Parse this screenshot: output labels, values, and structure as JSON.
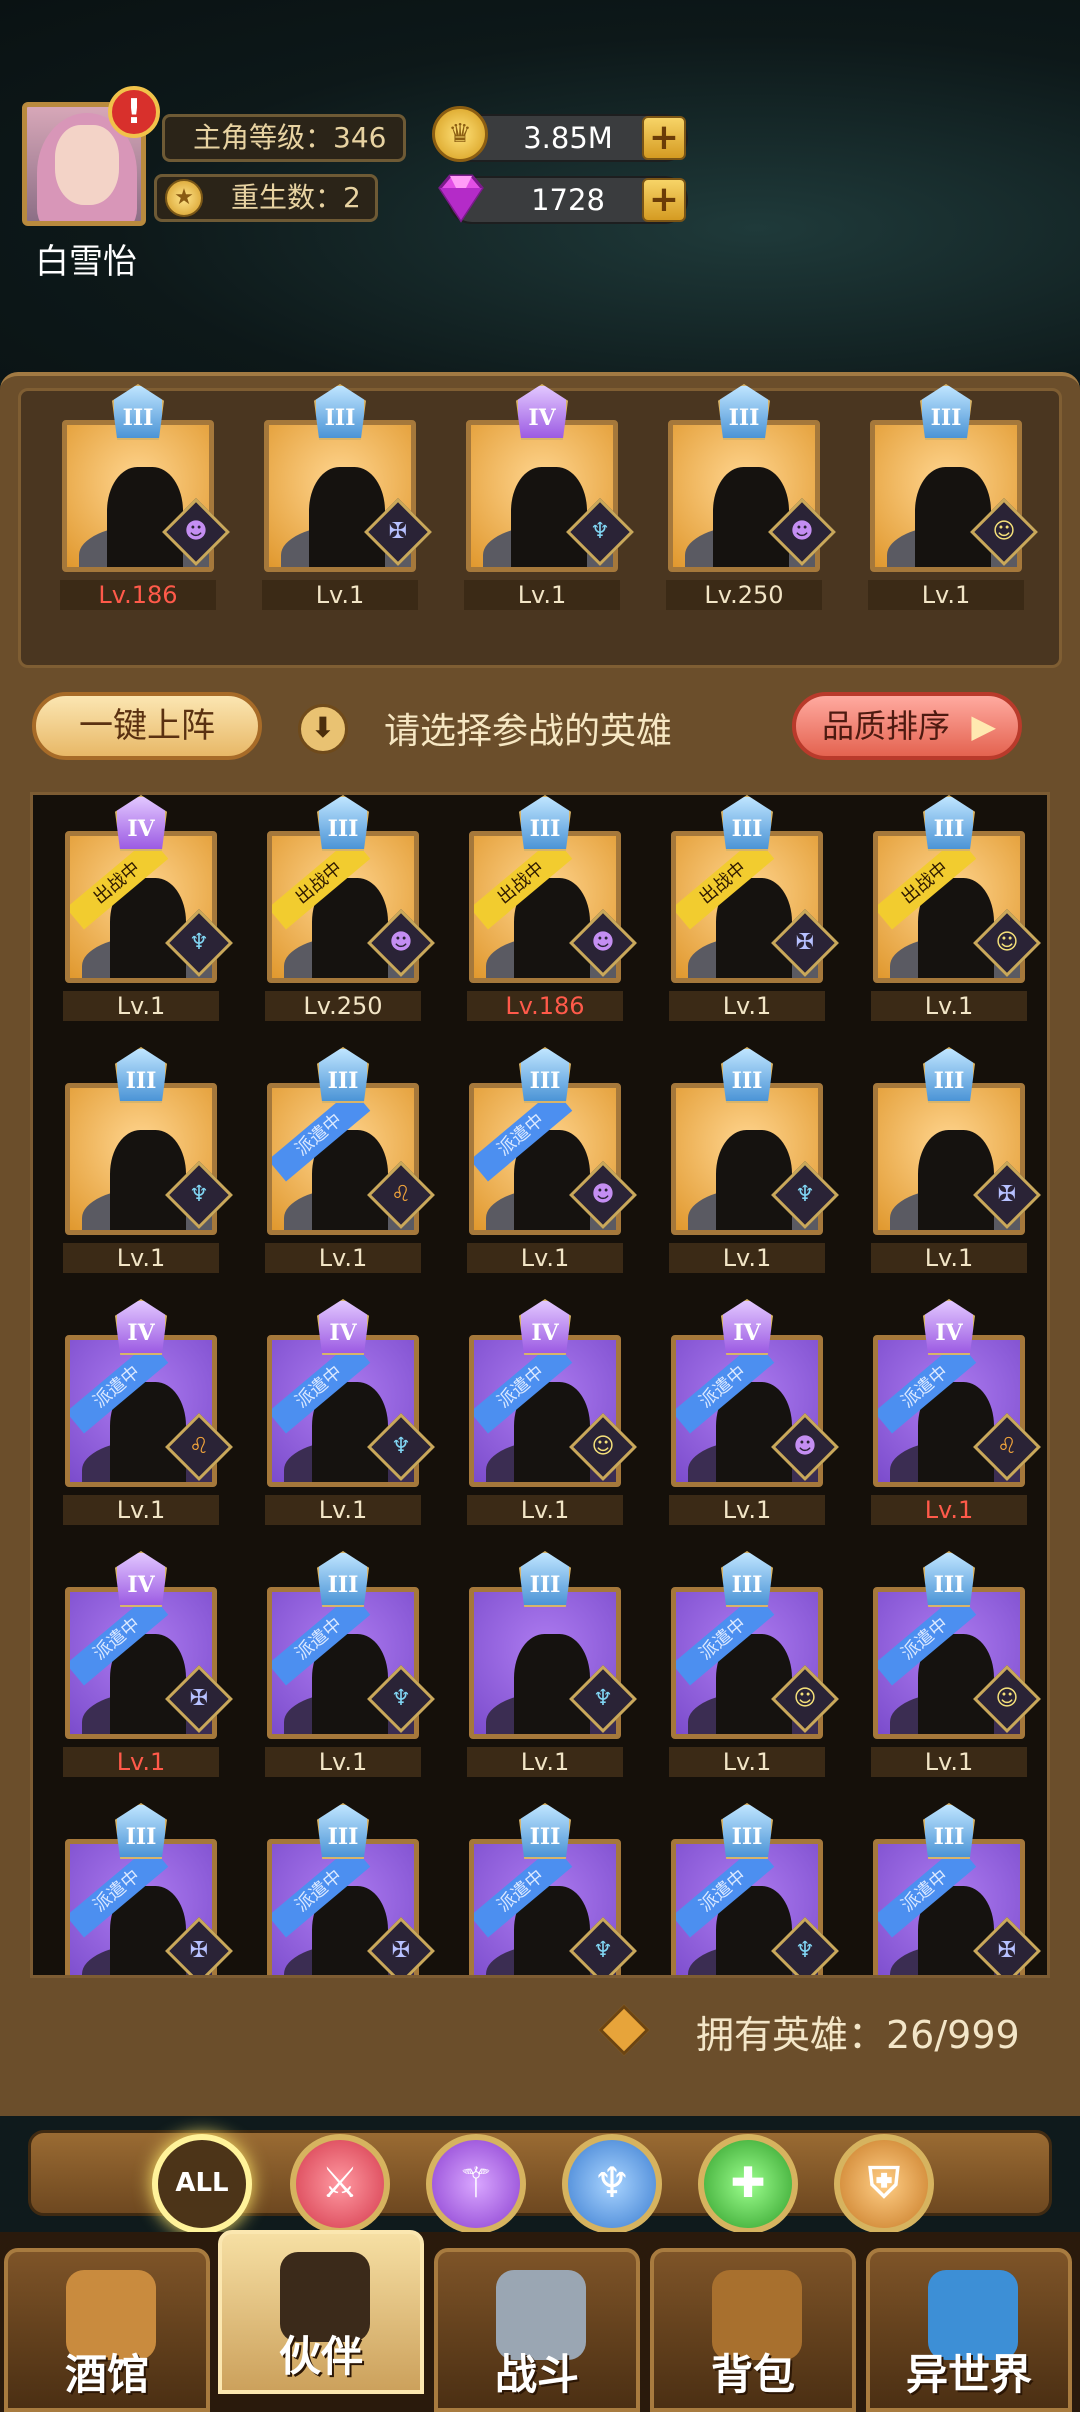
{
  "player": {
    "name": "白雪怡",
    "alert": "!",
    "level_text": "主角等级：346",
    "rebirth_text": "重生数：2",
    "gold": "3.85M",
    "gems": "1728"
  },
  "actions": {
    "deploy_label": "一键上阵",
    "prompt": "请选择参战的英雄",
    "sort_label": "品质排序"
  },
  "team": [
    {
      "tier": "III",
      "level": "Lv.186",
      "red": true,
      "color": "gold",
      "cls": "demon",
      "icon": "demon-icon"
    },
    {
      "tier": "III",
      "level": "Lv.1",
      "red": false,
      "color": "gold",
      "cls": "undead",
      "icon": "knight-icon"
    },
    {
      "tier": "IV",
      "level": "Lv.1",
      "red": false,
      "color": "gold",
      "cls": "elf",
      "icon": "elf-icon"
    },
    {
      "tier": "III",
      "level": "Lv.250",
      "red": false,
      "color": "gold",
      "cls": "demon",
      "icon": "demon-icon"
    },
    {
      "tier": "III",
      "level": "Lv.1",
      "red": false,
      "color": "gold",
      "cls": "human",
      "icon": "human-icon"
    }
  ],
  "roster": [
    {
      "tier": "IV",
      "level": "Lv.1",
      "red": false,
      "color": "gold",
      "status": "出战中",
      "st": "fight",
      "cls": "elf"
    },
    {
      "tier": "III",
      "level": "Lv.250",
      "red": false,
      "color": "gold",
      "status": "出战中",
      "st": "fight",
      "cls": "demon"
    },
    {
      "tier": "III",
      "level": "Lv.186",
      "red": true,
      "color": "gold",
      "status": "出战中",
      "st": "fight",
      "cls": "demon"
    },
    {
      "tier": "III",
      "level": "Lv.1",
      "red": false,
      "color": "gold",
      "status": "出战中",
      "st": "fight",
      "cls": "undead"
    },
    {
      "tier": "III",
      "level": "Lv.1",
      "red": false,
      "color": "gold",
      "status": "出战中",
      "st": "fight",
      "cls": "human"
    },
    {
      "tier": "III",
      "level": "Lv.1",
      "red": false,
      "color": "gold",
      "status": "",
      "st": "",
      "cls": "elf"
    },
    {
      "tier": "III",
      "level": "Lv.1",
      "red": false,
      "color": "gold",
      "status": "派遣中",
      "st": "dispatch",
      "cls": "beast"
    },
    {
      "tier": "III",
      "level": "Lv.1",
      "red": false,
      "color": "gold",
      "status": "派遣中",
      "st": "dispatch",
      "cls": "demon"
    },
    {
      "tier": "III",
      "level": "Lv.1",
      "red": false,
      "color": "gold",
      "status": "",
      "st": "",
      "cls": "elf"
    },
    {
      "tier": "III",
      "level": "Lv.1",
      "red": false,
      "color": "gold",
      "status": "",
      "st": "",
      "cls": "undead"
    },
    {
      "tier": "IV",
      "level": "Lv.1",
      "red": false,
      "color": "purple",
      "status": "派遣中",
      "st": "dispatch",
      "cls": "beast"
    },
    {
      "tier": "IV",
      "level": "Lv.1",
      "red": false,
      "color": "purple",
      "status": "派遣中",
      "st": "dispatch",
      "cls": "elf"
    },
    {
      "tier": "IV",
      "level": "Lv.1",
      "red": false,
      "color": "purple",
      "status": "派遣中",
      "st": "dispatch",
      "cls": "human"
    },
    {
      "tier": "IV",
      "level": "Lv.1",
      "red": false,
      "color": "purple",
      "status": "派遣中",
      "st": "dispatch",
      "cls": "demon"
    },
    {
      "tier": "IV",
      "level": "Lv.1",
      "red": true,
      "color": "purple",
      "status": "派遣中",
      "st": "dispatch",
      "cls": "beast"
    },
    {
      "tier": "IV",
      "level": "Lv.1",
      "red": true,
      "color": "purple",
      "status": "派遣中",
      "st": "dispatch",
      "cls": "undead"
    },
    {
      "tier": "III",
      "level": "Lv.1",
      "red": false,
      "color": "purple",
      "status": "派遣中",
      "st": "dispatch",
      "cls": "elf"
    },
    {
      "tier": "III",
      "level": "Lv.1",
      "red": false,
      "color": "purple",
      "status": "",
      "st": "",
      "cls": "elf"
    },
    {
      "tier": "III",
      "level": "Lv.1",
      "red": false,
      "color": "purple",
      "status": "派遣中",
      "st": "dispatch",
      "cls": "human"
    },
    {
      "tier": "III",
      "level": "Lv.1",
      "red": false,
      "color": "purple",
      "status": "派遣中",
      "st": "dispatch",
      "cls": "human"
    },
    {
      "tier": "III",
      "level": "",
      "red": false,
      "color": "purple",
      "status": "派遣中",
      "st": "dispatch",
      "cls": "undead"
    },
    {
      "tier": "III",
      "level": "",
      "red": false,
      "color": "purple",
      "status": "派遣中",
      "st": "dispatch",
      "cls": "undead"
    },
    {
      "tier": "III",
      "level": "",
      "red": false,
      "color": "purple",
      "status": "派遣中",
      "st": "dispatch",
      "cls": "elf"
    },
    {
      "tier": "III",
      "level": "",
      "red": false,
      "color": "purple",
      "status": "派遣中",
      "st": "dispatch",
      "cls": "elf"
    },
    {
      "tier": "III",
      "level": "",
      "red": false,
      "color": "purple",
      "status": "派遣中",
      "st": "dispatch",
      "cls": "undead"
    }
  ],
  "owned_text": "拥有英雄：26/999",
  "filters": [
    {
      "label": "ALL",
      "name": "filter-all",
      "active": true
    },
    {
      "label": "",
      "name": "filter-strength",
      "active": false
    },
    {
      "label": "",
      "name": "filter-magic",
      "active": false
    },
    {
      "label": "",
      "name": "filter-agility",
      "active": false
    },
    {
      "label": "",
      "name": "filter-heal",
      "active": false
    },
    {
      "label": "",
      "name": "filter-defense",
      "active": false
    }
  ],
  "nav": [
    {
      "label": "酒馆",
      "name": "nav-tavern",
      "icon": "beer-mug-icon",
      "active": false
    },
    {
      "label": "伙伴",
      "name": "nav-partners",
      "icon": "partner-face-icon",
      "active": true
    },
    {
      "label": "战斗",
      "name": "nav-battle",
      "icon": "crossed-swords-icon",
      "active": false
    },
    {
      "label": "背包",
      "name": "nav-bag",
      "icon": "chest-icon",
      "active": false
    },
    {
      "label": "异世界",
      "name": "nav-otherworld",
      "icon": "portal-icon",
      "active": false
    }
  ]
}
